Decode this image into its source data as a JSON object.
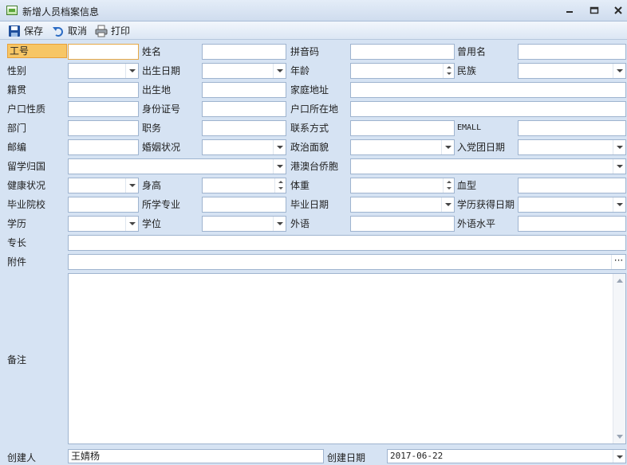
{
  "window": {
    "title": "新增人员档案信息"
  },
  "toolbar": {
    "save_label": "保存",
    "cancel_label": "取消",
    "print_label": "打印"
  },
  "form": {
    "employee_id_label": "工号",
    "name_label": "姓名",
    "pinyin_label": "拼音码",
    "former_name_label": "曾用名",
    "gender_label": "性别",
    "birth_date_label": "出生日期",
    "age_label": "年龄",
    "ethnicity_label": "民族",
    "native_place_label": "籍贯",
    "birthplace_label": "出生地",
    "home_address_label": "家庭地址",
    "hukou_type_label": "户口性质",
    "id_number_label": "身份证号",
    "hukou_location_label": "户口所在地",
    "department_label": "部门",
    "position_label": "职务",
    "contact_label": "联系方式",
    "email_label": "EMALL",
    "postcode_label": "邮编",
    "marital_status_label": "婚姻状况",
    "political_status_label": "政治面貌",
    "party_join_date_label": "入党团日期",
    "returnee_label": "留学归国",
    "overseas_chinese_label": "港澳台侨胞",
    "health_label": "健康状况",
    "height_label": "身高",
    "weight_label": "体重",
    "blood_type_label": "血型",
    "school_label": "毕业院校",
    "major_label": "所学专业",
    "graduation_date_label": "毕业日期",
    "degree_obtained_date_label": "学历获得日期",
    "education_label": "学历",
    "academic_degree_label": "学位",
    "foreign_language_label": "外语",
    "language_level_label": "外语水平",
    "specialty_label": "专长",
    "attachment_label": "附件",
    "attachment_button": "···",
    "remarks_label": "备注",
    "creator_label": "创建人",
    "creator_value": "王婧杨",
    "created_date_label": "创建日期",
    "created_date_value": "2017-06-22"
  }
}
